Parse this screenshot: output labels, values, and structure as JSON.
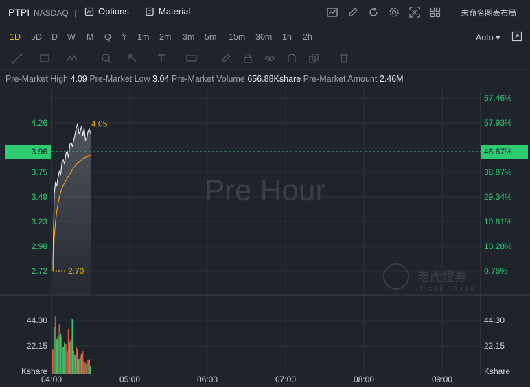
{
  "header": {
    "symbol": "PTPI",
    "exchange": "NASDAQ",
    "options_label": "Options",
    "material_label": "Material",
    "layout_name": "未命名图表布局"
  },
  "intervals": [
    "1D",
    "5D",
    "D",
    "W",
    "M",
    "Q",
    "Y",
    "1m",
    "2m",
    "3m",
    "5m",
    "15m",
    "30m",
    "1h",
    "2h"
  ],
  "active_interval": "1D",
  "scale_mode": "Auto",
  "stats": {
    "high_label": "Pre-Market High",
    "high_value": "4.09",
    "low_label": "Pre-Market Low",
    "low_value": "3.04",
    "volume_label": "Pre-Market Volume",
    "volume_value": "656.88Kshare",
    "amount_label": "Pre-Market Amount",
    "amount_value": "2.46M"
  },
  "watermark": "Pre Hour",
  "brand_watermark": {
    "name": "老虎證券",
    "sub": "TIGER TRADE"
  },
  "chart_data": {
    "type": "line",
    "price_ticks": [
      "4.26",
      "3.75",
      "3.49",
      "3.23",
      "2.98",
      "2.72"
    ],
    "pct_ticks": [
      "67.46%",
      "57.93%",
      "38.87%",
      "29.34%",
      "19.81%",
      "10.28%",
      "0.75%"
    ],
    "current_price": "3.96",
    "current_pct": "46.67%",
    "max_label": "4.05",
    "min_label": "2.70",
    "volume_ticks": [
      "44.30",
      "22.15"
    ],
    "volume_unit": "Kshare",
    "time_ticks": [
      "04:00",
      "05:00",
      "06:00",
      "07:00",
      "08:00",
      "09:00"
    ],
    "ylim": [
      2.48,
      4.38
    ],
    "xlim": [
      0,
      330
    ],
    "price_x": [
      0,
      1,
      2,
      3,
      4,
      5,
      6,
      7,
      8,
      9,
      10,
      11,
      12,
      13,
      14,
      15,
      16,
      17,
      18,
      19,
      20,
      21,
      22,
      23,
      24,
      25,
      26,
      27,
      28,
      29
    ],
    "price": [
      2.7,
      3.4,
      3.52,
      3.48,
      3.56,
      3.62,
      3.58,
      3.7,
      3.72,
      3.68,
      3.78,
      3.8,
      3.74,
      3.86,
      3.88,
      3.84,
      3.9,
      3.95,
      4.02,
      4.05,
      3.96,
      3.98,
      4.03,
      3.94,
      4.01,
      3.9,
      3.92,
      3.98,
      4.0,
      3.96
    ],
    "avg": [
      2.7,
      3.0,
      3.15,
      3.25,
      3.32,
      3.38,
      3.42,
      3.46,
      3.49,
      3.51,
      3.53,
      3.55,
      3.57,
      3.59,
      3.61,
      3.63,
      3.65,
      3.66,
      3.68,
      3.69,
      3.7,
      3.71,
      3.72,
      3.73,
      3.74,
      3.74,
      3.75,
      3.75,
      3.76,
      3.76
    ],
    "volume_up": [
      0,
      38,
      0,
      28,
      30,
      0,
      32,
      0,
      22,
      25,
      0,
      18,
      0,
      26,
      0,
      44,
      0,
      15,
      0,
      20,
      12,
      0,
      16,
      0,
      10,
      0,
      8,
      0,
      12,
      6
    ],
    "volume_down": [
      20,
      0,
      46,
      0,
      0,
      40,
      0,
      30,
      0,
      0,
      24,
      0,
      36,
      0,
      28,
      0,
      19,
      0,
      22,
      0,
      0,
      14,
      0,
      18,
      0,
      9,
      0,
      11,
      0,
      5
    ],
    "colors": {
      "up": "#2ecc71",
      "down": "#e74c3c",
      "price": "#e6e8ec",
      "avg": "#f39c12",
      "label": "#f2b705"
    }
  }
}
